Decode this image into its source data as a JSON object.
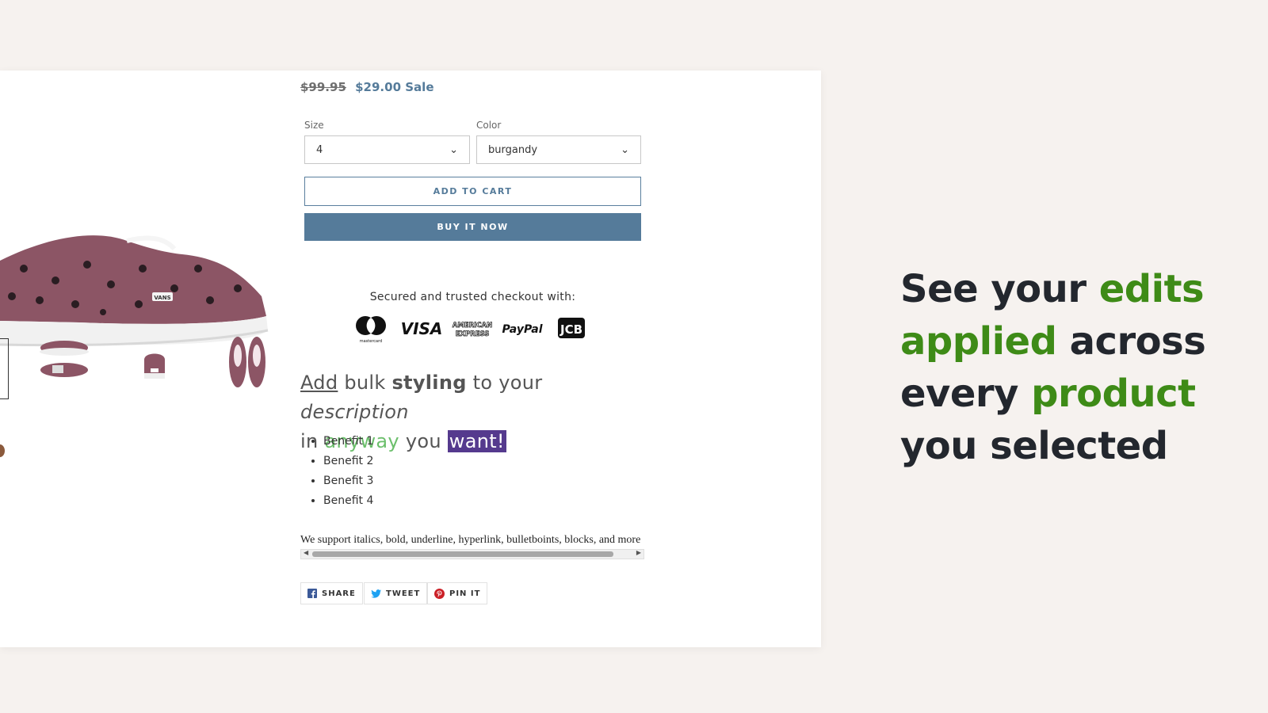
{
  "product": {
    "price_original": "$99.95",
    "price_sale": "$29.00",
    "sale_label": "Sale",
    "size": {
      "label": "Size",
      "value": "4"
    },
    "color": {
      "label": "Color",
      "value": "burgandy"
    },
    "add_to_cart": "ADD TO CART",
    "buy_now": "BUY IT NOW",
    "secured_text": "Secured and trusted checkout with:",
    "payment_icons": [
      "mastercard-icon",
      "visa-icon",
      "american-express-icon",
      "paypal-icon",
      "jcb-icon"
    ],
    "payment_text": {
      "mastercard": "mastercard",
      "visa": "VISA",
      "amex_line1": "AMERICAN",
      "amex_line2": "EXPRESS",
      "paypal": "PayPal",
      "jcb": "JCB"
    },
    "shoe_brand": "VANS"
  },
  "description": {
    "w_add": "Add",
    "w_bulk": "bulk",
    "w_styling": "styling",
    "w_to_your": "to your",
    "w_description": "description",
    "w_in": "in",
    "w_anyway": "anyway",
    "w_you": "you",
    "w_want": "want!",
    "benefits": [
      "Benefit 1",
      "Benefit 2",
      "Benefit 3",
      "Benefit 4"
    ],
    "support_text": "We support italics, bold, underline, hyperlink, bulletboints, blocks, and more"
  },
  "share": {
    "facebook": "SHARE",
    "twitter": "TWEET",
    "pinterest": "PIN IT"
  },
  "headline": {
    "l1a": "See your",
    "l1b": "edits",
    "l2a": "applied",
    "l2b": "across",
    "l3a": "every",
    "l3b": "product",
    "l4": "you selected"
  },
  "colors": {
    "accent_blue": "#557b9a",
    "headline_green": "#3e8b17",
    "headline_dark": "#23272e",
    "highlight_purple": "#553a8e",
    "text_green": "#6cbf6c",
    "background": "#f6f2ef"
  }
}
